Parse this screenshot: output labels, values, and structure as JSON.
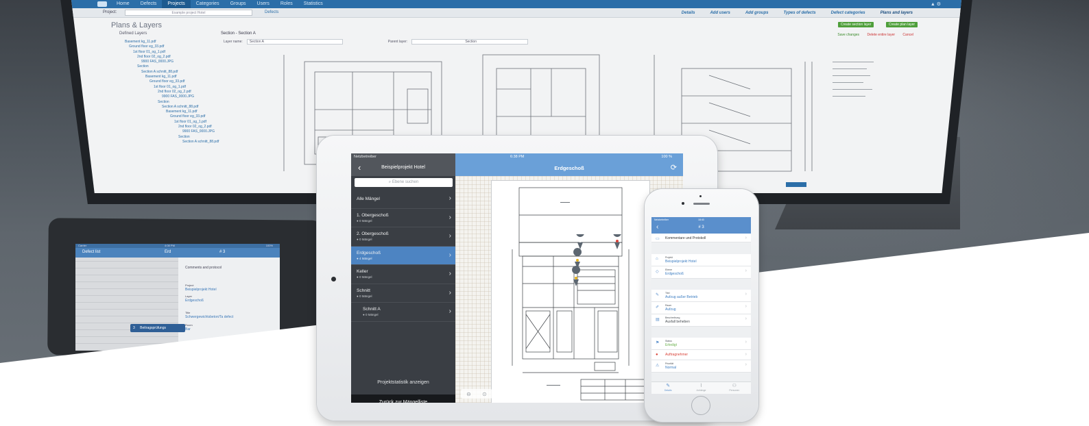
{
  "monitor": {
    "nav_items": [
      "Home",
      "Defects",
      "Projects",
      "Categories",
      "Groups",
      "Users",
      "Roles",
      "Statistics"
    ],
    "nav_active": "Projects",
    "project_label": "Project:",
    "project_value": "Example project Hotel",
    "defects_link": "Defects",
    "sub_tabs": [
      "Details",
      "Add users",
      "Add groups",
      "Types of defects",
      "Defect categories",
      "Plans and layers"
    ],
    "page_title": "Plans & Layers",
    "btn_create_section": "Create section layer",
    "btn_create_plan": "Create plan layer",
    "actions": {
      "save": "Save changes",
      "delete": "Delete entire layer",
      "cancel": "Cancel"
    },
    "tree_title": "Defined Layers",
    "tree": [
      "Basement kg_11.pdf",
      "Ground floor eg_33.pdf",
      "1st floor 01_og_1.pdf",
      "2nd floor 02_og_2.pdf",
      "9900 FAS_0000.JPG",
      "Section",
      "Section A schnitt_88.pdf",
      "Basement kg_11.pdf",
      "Ground floor eg_33.pdf",
      "1st floor 01_og_1.pdf",
      "2nd floor 02_og_2.pdf",
      "9900 FAS_0000.JPG",
      "Section",
      "Section A schnitt_88.pdf",
      "Basement kg_11.pdf",
      "Ground floor eg_33.pdf",
      "1st floor 01_og_1.pdf",
      "2nd floor 02_og_2.pdf",
      "9900 FAS_0000.JPG",
      "Section",
      "Section A schnitt_88.pdf"
    ],
    "section_label": "Section - Section A",
    "layer_name_label": "Layer name:",
    "layer_name_value": "Section A",
    "parent_layer_label": "Parent layer:",
    "parent_layer_value": "Section"
  },
  "bg_tablet": {
    "status_left": "Carrier",
    "status_time": "4:08 PM",
    "status_battery": "100%",
    "left_title": "Defect list",
    "center_title": "Erd",
    "right_title": "# 3",
    "rows": [
      {
        "label": "Comments and protocol",
        "value": ""
      },
      {
        "label": "Project",
        "value": "Beispielprojekt Hotel"
      },
      {
        "label": "Layer",
        "value": "Erdgeschoß"
      },
      {
        "label": "Title",
        "value": "Schwergewichtsbeton/Ta defect"
      },
      {
        "label": "Room",
        "value": "Bar"
      },
      {
        "label": "Description",
        "value": ""
      }
    ],
    "chip_number": "3",
    "chip_text": "Beitragsprüfungs"
  },
  "ipad": {
    "status_carrier": "Netzbetreiber",
    "status_time": "6:38 PM",
    "status_battery": "100 %",
    "sidebar_title": "Beispielprojekt Hotel",
    "search_placeholder": "Ebene suchen",
    "layers": [
      {
        "label": "Alle Mängel",
        "sub": ""
      },
      {
        "label": "1. Obergeschoß",
        "sub": "● 0 Mängel"
      },
      {
        "label": "2. Obergeschoß",
        "sub": "● 0 Mängel"
      },
      {
        "label": "Erdgeschoß",
        "sub": "● 4 Mängel"
      },
      {
        "label": "Keller",
        "sub": "● 0 Mängel"
      },
      {
        "label": "Schnitt",
        "sub": "● 0 Mängel"
      },
      {
        "label": "Schnitt A",
        "sub": "● 0 Mängel"
      }
    ],
    "active_layer": "Erdgeschoß",
    "stats_link": "Projektstatistik anzeigen",
    "back_to_list": "Zurück zur Mängelliste",
    "plan_title": "Erdgeschoß",
    "pin_colors": {
      "grey": "#5c6670",
      "red": "#d9443a",
      "yellow": "#e3b21f"
    }
  },
  "iphone": {
    "status_carrier": "Netzbetreiber",
    "status_time": "18:40",
    "title": "# 3",
    "comments": "Kommentare und Protokoll",
    "project_label": "Projekt",
    "project_value": "Beispielprojekt Hotel",
    "layer_label": "Ebene",
    "layer_value": "Erdgeschoß",
    "title_label": "Titel",
    "title_value": "Aufzug außer Betrieb",
    "room_label": "Raum",
    "room_value": "Aufzug",
    "desc_label": "Beschreibung",
    "desc_value": "Ausfall beheben",
    "status_label": "Status",
    "status_value": "Erledigt",
    "assignee": "Auftragnehmer",
    "priority_label": "Priorität",
    "priority_value": "Normal",
    "tabs": [
      "Details",
      "Anhänge",
      "Personen"
    ]
  },
  "colors": {
    "accent_blue": "#6aa0d8",
    "nav_blue": "#2b6ea8",
    "sidebar_dark": "#3a3e44",
    "status_green": "#6ab04c",
    "assignee_red": "#d9443a"
  }
}
